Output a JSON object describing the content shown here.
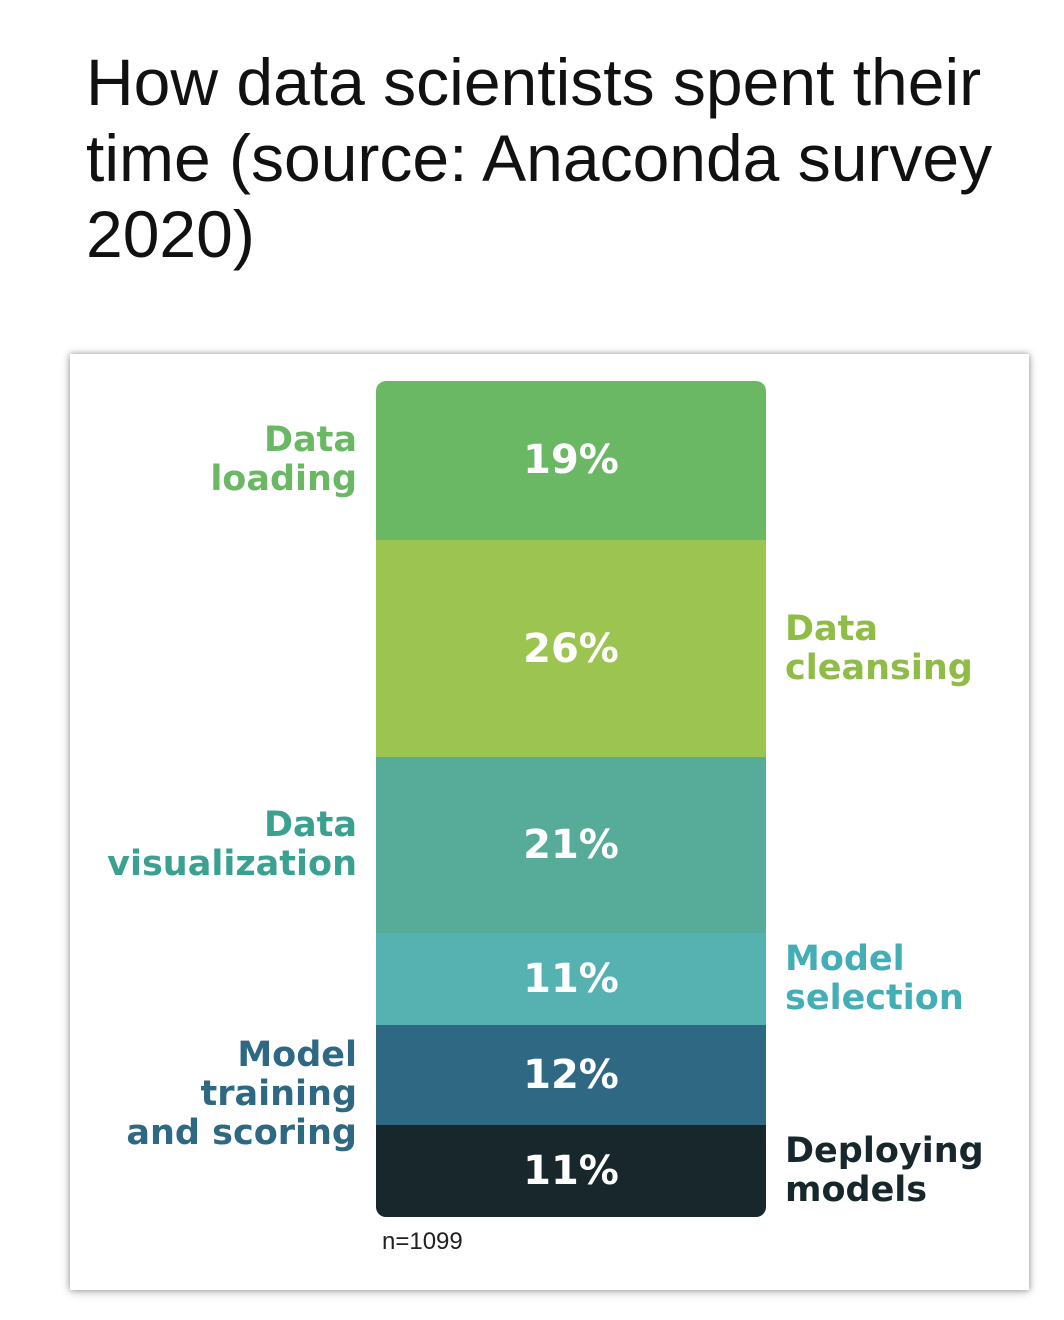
{
  "title": "How data scientists spent their time (source: Anaconda survey 2020)",
  "sample_note": "n=1099",
  "chart_data": {
    "type": "bar",
    "stacked": true,
    "orientation": "vertical",
    "categories": [
      "Data loading",
      "Data cleansing",
      "Data visualization",
      "Model selection",
      "Model training and scoring",
      "Deploying models"
    ],
    "values": [
      19,
      26,
      21,
      11,
      12,
      11
    ],
    "data_labels": [
      "19%",
      "26%",
      "21%",
      "11%",
      "12%",
      "11%"
    ],
    "colors": [
      "#6ab764",
      "#9bc450",
      "#56ab99",
      "#56b2b1",
      "#2e6883",
      "#17272b"
    ],
    "label_colors": [
      "#6ab764",
      "#8fbc45",
      "#3aa08f",
      "#43aeb5",
      "#2e6883",
      "#17272b"
    ],
    "label_sides": [
      "left",
      "right",
      "left",
      "right",
      "left",
      "right"
    ],
    "label_lines": [
      [
        "Data",
        "loading"
      ],
      [
        "Data",
        "cleansing"
      ],
      [
        "Data",
        "visualization"
      ],
      [
        "Model",
        "selection"
      ],
      [
        "Model training",
        "and scoring"
      ],
      [
        "Deploying",
        "models"
      ]
    ],
    "unit": "%"
  }
}
